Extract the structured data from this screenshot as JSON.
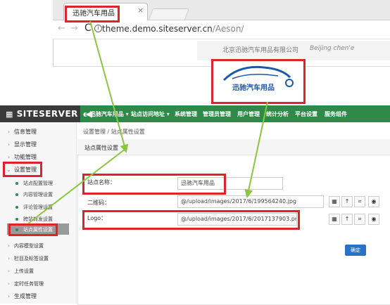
{
  "browser": {
    "tab_title": "迅驰汽车用品",
    "url_host": "theme.demo.siteserver.cn",
    "url_path": "/Aeson/",
    "site_company": "北京迅驰汽车用品有限公司",
    "site_company_en": "Beijing chen'e"
  },
  "logo": {
    "text": "迅驰汽车用品"
  },
  "admin": {
    "brand": "SITESERVER",
    "menu": [
      "迅驰汽车用品 ▾",
      "站点访问地址 ▾",
      "系统管理",
      "管理员管理",
      "用户管理",
      "统计分析",
      "平台设置",
      "服务组件"
    ],
    "sidebar": [
      {
        "label": "信息管理",
        "icon": "list-icon"
      },
      {
        "label": "显示管理",
        "icon": "palette-icon"
      },
      {
        "label": "功能管理",
        "icon": "wrench-icon"
      },
      {
        "label": "设置管理",
        "icon": "gear-icon"
      },
      {
        "label": "生成管理",
        "icon": "globe-icon"
      }
    ],
    "sub_items": [
      "站点配置管理",
      "内容管理设置",
      "评论管理设置",
      "跨站转发设置",
      "站点属性设置",
      "内容模型设置",
      "栏目及标签设置",
      "上传设置",
      "定时任务管理"
    ],
    "breadcrumb": "设置管理 / 站点属性设置",
    "panel_title": "站点属性设置",
    "form": {
      "site_name_label": "站点名称：",
      "site_name_value": "迅驰汽车用品",
      "qrcode_label": "二维码：",
      "qrcode_value": "@/upload/images/2017/6/199564240.jpg",
      "logo_label": "Logo：",
      "logo_value": "@/upload/images/2017/6/2017137903.png",
      "submit": "确定"
    }
  },
  "colors": {
    "highlight": "#e0232a",
    "arrow": "#8cc63f",
    "green": "#2f8a4a",
    "logo_blue": "#1c5aa8"
  }
}
